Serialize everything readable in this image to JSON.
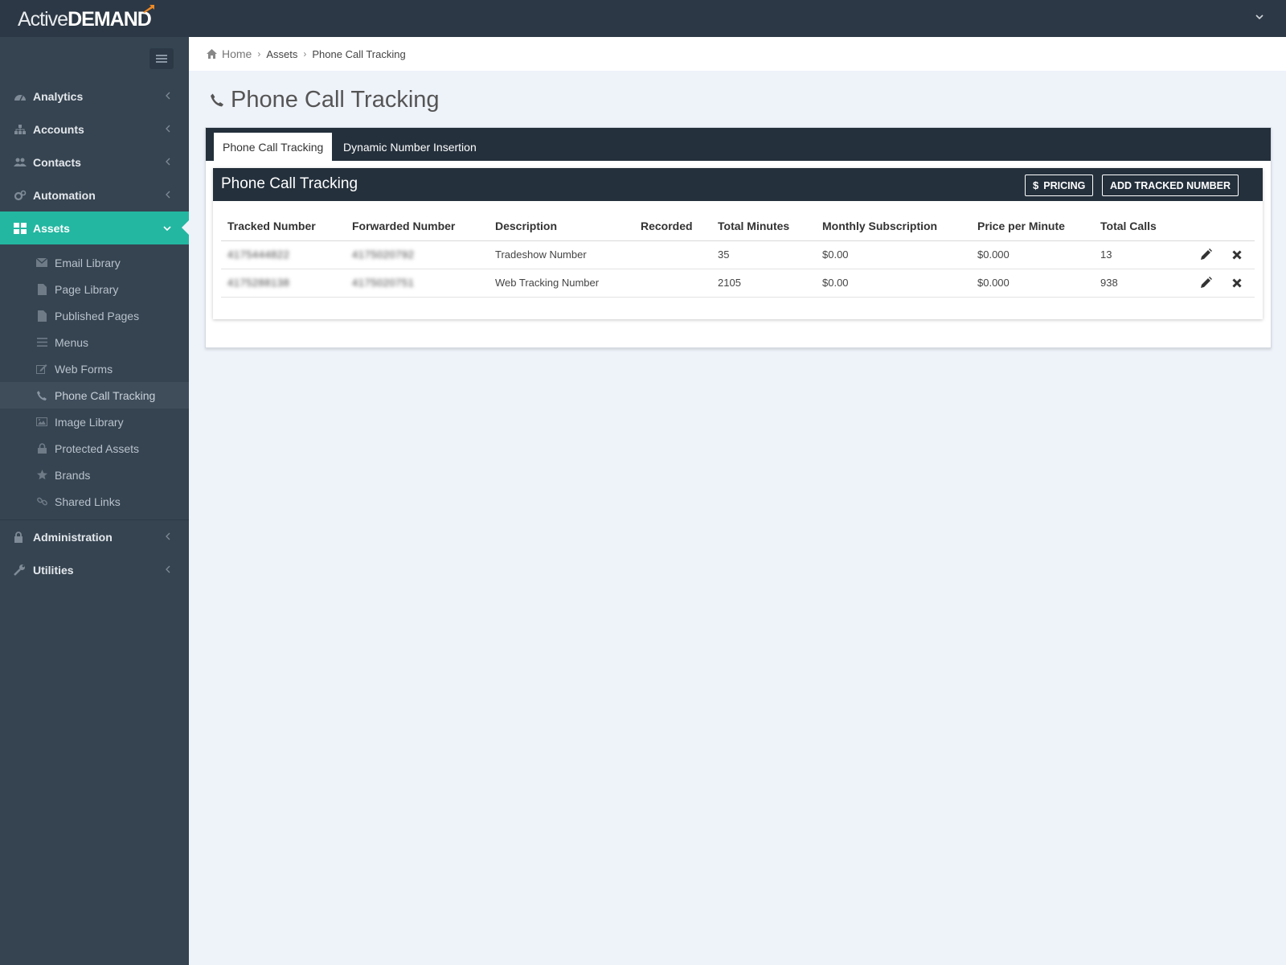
{
  "brand": {
    "logo_part1": "Active",
    "logo_part2": "DEMAND"
  },
  "sidebar": {
    "main_items": [
      {
        "label": "Analytics",
        "icon": "dashboard-icon"
      },
      {
        "label": "Accounts",
        "icon": "sitemap-icon"
      },
      {
        "label": "Contacts",
        "icon": "users-icon"
      },
      {
        "label": "Automation",
        "icon": "cogs-icon"
      },
      {
        "label": "Assets",
        "icon": "grid-icon",
        "active": true
      }
    ],
    "asset_items": [
      {
        "label": "Email Library",
        "icon": "envelope-icon"
      },
      {
        "label": "Page Library",
        "icon": "file-icon"
      },
      {
        "label": "Published Pages",
        "icon": "file-icon"
      },
      {
        "label": "Menus",
        "icon": "list-icon"
      },
      {
        "label": "Web Forms",
        "icon": "edit-icon"
      },
      {
        "label": "Phone Call Tracking",
        "icon": "phone-icon",
        "active": true
      },
      {
        "label": "Image Library",
        "icon": "image-icon"
      },
      {
        "label": "Protected Assets",
        "icon": "lock-icon"
      },
      {
        "label": "Brands",
        "icon": "star-icon"
      },
      {
        "label": "Shared Links",
        "icon": "link-icon"
      }
    ],
    "bottom_items": [
      {
        "label": "Administration",
        "icon": "lock-icon"
      },
      {
        "label": "Utilities",
        "icon": "wrench-icon"
      }
    ]
  },
  "breadcrumb": {
    "home": "Home",
    "assets": "Assets",
    "current": "Phone Call Tracking"
  },
  "page": {
    "title": "Phone Call Tracking"
  },
  "tabs": [
    {
      "label": "Phone Call Tracking",
      "active": true
    },
    {
      "label": "Dynamic Number Insertion",
      "active": false
    }
  ],
  "panel": {
    "title": "Phone Call Tracking",
    "pricing_label": "PRICING",
    "add_label": "ADD TRACKED NUMBER"
  },
  "table": {
    "columns": [
      "Tracked Number",
      "Forwarded Number",
      "Description",
      "Recorded",
      "Total Minutes",
      "Monthly Subscription",
      "Price per Minute",
      "Total Calls"
    ],
    "rows": [
      {
        "tracked": "4175444822",
        "forwarded": "4175020792",
        "description": "Tradeshow Number",
        "recorded": "",
        "minutes": "35",
        "monthly": "$0.00",
        "price": "$0.000",
        "calls": "13"
      },
      {
        "tracked": "4175288138",
        "forwarded": "4175020751",
        "description": "Web Tracking Number",
        "recorded": "",
        "minutes": "2105",
        "monthly": "$0.00",
        "price": "$0.000",
        "calls": "938"
      }
    ]
  },
  "colors": {
    "topbar": "#2c3845",
    "sidebar": "#364451",
    "accent": "#23b7a1",
    "header_dark": "#24303c",
    "page_bg": "#eef2f9"
  }
}
